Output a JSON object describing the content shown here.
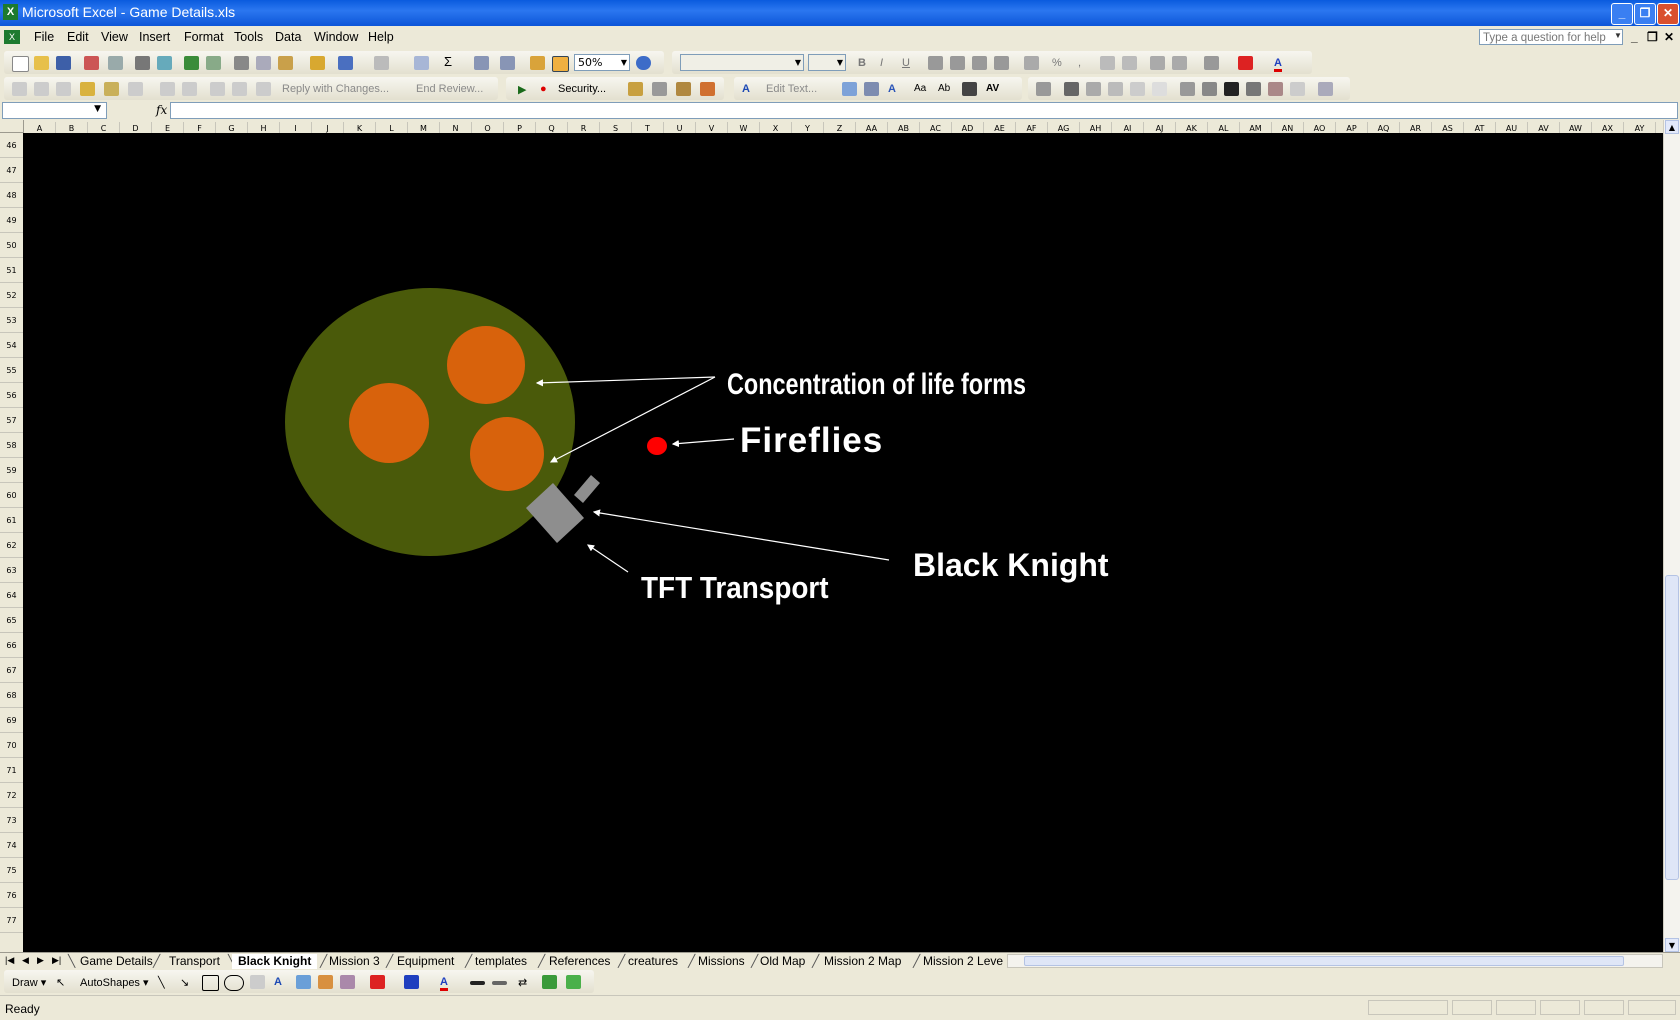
{
  "window": {
    "title": "Microsoft Excel - Game Details.xls"
  },
  "menu": {
    "items": [
      "File",
      "Edit",
      "View",
      "Insert",
      "Format",
      "Tools",
      "Data",
      "Window",
      "Help"
    ],
    "help_placeholder": "Type a question for help"
  },
  "toolbar": {
    "zoom": "50%",
    "font_name": "",
    "font_size": "",
    "bold": "B",
    "italic": "I",
    "underline": "U",
    "reply_with_changes": "Reply with Changes...",
    "end_review": "End Review...",
    "security": "Security...",
    "edit_text": "Edit Text..."
  },
  "formula_bar": {
    "name_box": "",
    "fx": "fx",
    "content": ""
  },
  "columns": [
    "A",
    "B",
    "C",
    "D",
    "E",
    "F",
    "G",
    "H",
    "I",
    "J",
    "K",
    "L",
    "M",
    "N",
    "O",
    "P",
    "Q",
    "R",
    "S",
    "T",
    "U",
    "V",
    "W",
    "X",
    "Y",
    "Z",
    "AA",
    "AB",
    "AC",
    "AD",
    "AE",
    "AF",
    "AG",
    "AH",
    "AI",
    "AJ",
    "AK",
    "AL",
    "AM",
    "AN",
    "AO",
    "AP",
    "AQ",
    "AR",
    "AS",
    "AT",
    "AU",
    "AV",
    "AW",
    "AX",
    "AY"
  ],
  "rows": [
    "46",
    "47",
    "48",
    "49",
    "50",
    "51",
    "52",
    "53",
    "54",
    "55",
    "56",
    "57",
    "58",
    "59",
    "60",
    "61",
    "62",
    "63",
    "64",
    "65",
    "66",
    "67",
    "68",
    "69",
    "70",
    "71",
    "72",
    "73",
    "74",
    "75",
    "76",
    "77"
  ],
  "diagram": {
    "labels": {
      "life_forms": "Concentration of life forms",
      "fireflies": "Fireflies",
      "black_knight": "Black Knight",
      "tft_transport": "TFT Transport"
    },
    "colors": {
      "background": "#000000",
      "planet": "#4a5a0a",
      "life_form": "#d8620c",
      "firefly": "#ff0000",
      "vehicle": "#8e8e8e",
      "text": "#ffffff"
    }
  },
  "sheet_tabs": {
    "tabs": [
      "Game Details",
      "Transport",
      "Black Knight",
      "Mission 3",
      "Equipment",
      "templates",
      "References",
      "creatures",
      "Missions",
      "Old Map",
      "Mission 2 Map",
      "Mission 2 Leve"
    ],
    "active": "Black Knight"
  },
  "drawing_toolbar": {
    "draw": "Draw",
    "autoshapes": "AutoShapes"
  },
  "status": {
    "text": "Ready"
  }
}
